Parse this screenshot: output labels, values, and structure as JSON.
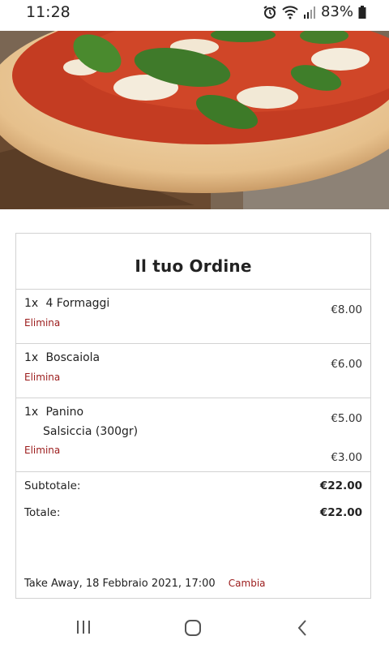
{
  "status_bar": {
    "time": "11:28",
    "battery": "83%"
  },
  "order": {
    "title": "Il tuo Ordine",
    "items": [
      {
        "qty": "1x",
        "name": "4 Formaggi",
        "remove": "Elimina",
        "price": "€8.00"
      },
      {
        "qty": "1x",
        "name": "Boscaiola",
        "remove": "Elimina",
        "price": "€6.00"
      },
      {
        "qty": "1x",
        "name": "Panino",
        "option": "Salsiccia (300gr)",
        "remove": "Elimina",
        "price": "€5.00",
        "option_price": "€3.00"
      }
    ],
    "subtotal_label": "Subtotale:",
    "subtotal": "€22.00",
    "total_label": "Totale:",
    "total": "€22.00",
    "delivery": "Take Away, 18 Febbraio 2021, 17:00",
    "change_label": "Cambia"
  },
  "colors": {
    "accent": "#9b1b1b",
    "border": "#d2d2d2"
  },
  "icons": [
    "alarm-icon",
    "wifi-icon",
    "signal-icon",
    "battery-icon",
    "recents-icon",
    "home-icon",
    "back-icon"
  ]
}
